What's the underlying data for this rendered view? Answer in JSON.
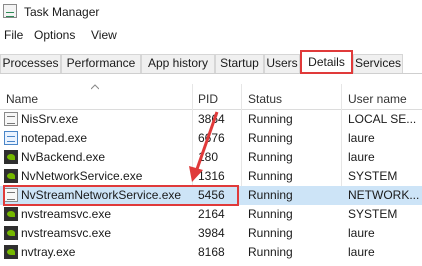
{
  "window": {
    "title": "Task Manager",
    "icon": "task-manager-icon"
  },
  "menu": [
    "File",
    "Options",
    "View"
  ],
  "tabs": [
    "Processes",
    "Performance",
    "App history",
    "Startup",
    "Users",
    "Details",
    "Services"
  ],
  "active_tab": "Details",
  "columns": [
    "Name",
    "PID",
    "Status",
    "User name"
  ],
  "sort": {
    "column": "Name",
    "direction": "up"
  },
  "rows": [
    {
      "name": "NisSrv.exe",
      "pid": "3864",
      "status": "Running",
      "user": "LOCAL SE...",
      "icon": "generic-process-icon"
    },
    {
      "name": "notepad.exe",
      "pid": "6676",
      "status": "Running",
      "user": "laure",
      "icon": "notepad-icon"
    },
    {
      "name": "NvBackend.exe",
      "pid": "180",
      "status": "Running",
      "user": "laure",
      "icon": "nvidia-icon"
    },
    {
      "name": "NvNetworkService.exe",
      "pid": "1316",
      "status": "Running",
      "user": "SYSTEM",
      "icon": "nvidia-icon"
    },
    {
      "name": "NvStreamNetworkService.exe",
      "pid": "5456",
      "status": "Running",
      "user": "NETWORK...",
      "icon": "generic-process-icon",
      "selected": true
    },
    {
      "name": "nvstreamsvc.exe",
      "pid": "2164",
      "status": "Running",
      "user": "SYSTEM",
      "icon": "nvidia-icon"
    },
    {
      "name": "nvstreamsvc.exe",
      "pid": "3984",
      "status": "Running",
      "user": "laure",
      "icon": "nvidia-icon"
    },
    {
      "name": "nvtray.exe",
      "pid": "8168",
      "status": "Running",
      "user": "laure",
      "icon": "nvidia-icon"
    }
  ],
  "annotation_color": "#e03a3a",
  "selection_color": "#cde4f7"
}
